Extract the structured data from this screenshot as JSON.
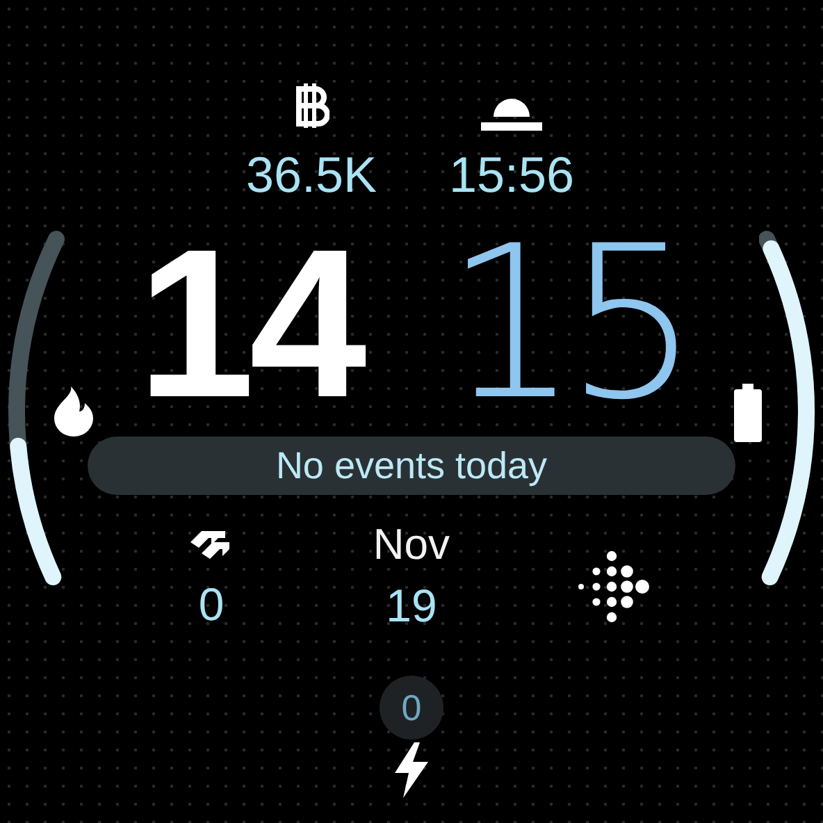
{
  "top_complications": [
    {
      "kind": "bitcoin",
      "value": "36.5K"
    },
    {
      "kind": "sunrise",
      "value": "15:56"
    }
  ],
  "time": {
    "hours": "14",
    "minutes": "15"
  },
  "left_gauge": {
    "kind": "calories"
  },
  "right_gauge": {
    "kind": "battery"
  },
  "events": {
    "text": "No events today"
  },
  "bottom_complications": [
    {
      "kind": "floors",
      "value": "0"
    },
    {
      "kind": "date",
      "label": "Nov",
      "value": "19"
    },
    {
      "kind": "fitbit"
    }
  ],
  "bottom_button": {
    "value": "0"
  }
}
